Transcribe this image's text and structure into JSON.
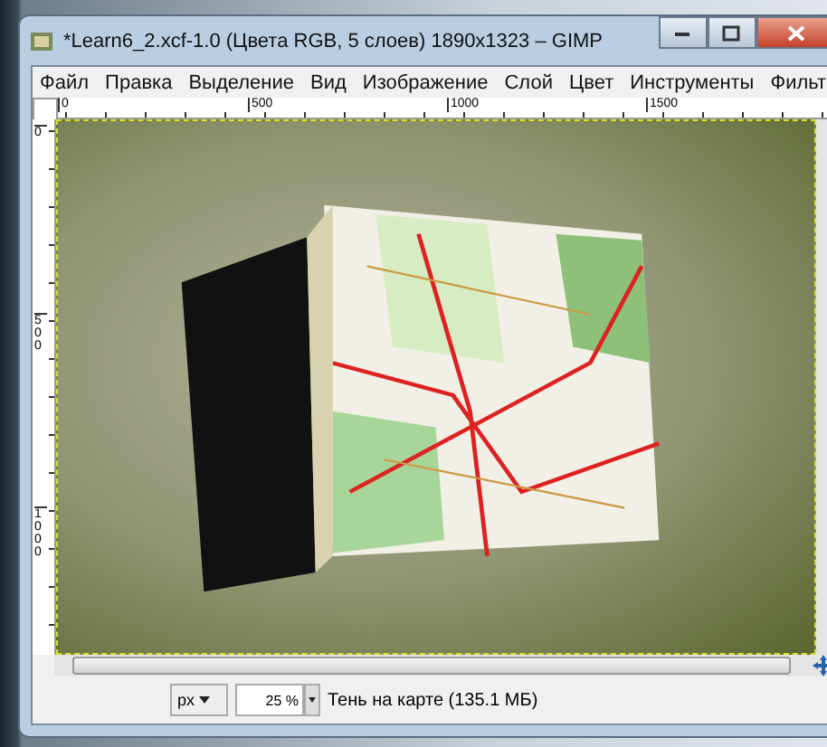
{
  "window": {
    "title": "*Learn6_2.xcf-1.0 (Цвета RGB, 5 слоев) 1890x1323 – GIMP"
  },
  "menu": [
    {
      "label": "Файл"
    },
    {
      "label": "Правка"
    },
    {
      "label": "Выделение"
    },
    {
      "label": "Вид"
    },
    {
      "label": "Изображение"
    },
    {
      "label": "Слой"
    },
    {
      "label": "Цвет"
    },
    {
      "label": "Инструменты"
    },
    {
      "label": "Фильт"
    }
  ],
  "horizontal_ruler": {
    "labels": [
      "0",
      "500",
      "1000",
      "1500"
    ]
  },
  "vertical_ruler": {
    "labels": [
      "0",
      "500",
      "1000"
    ]
  },
  "status_bar": {
    "unit": "px",
    "zoom": "25 %",
    "info": "Тень на карте (135.1 МБ)"
  }
}
